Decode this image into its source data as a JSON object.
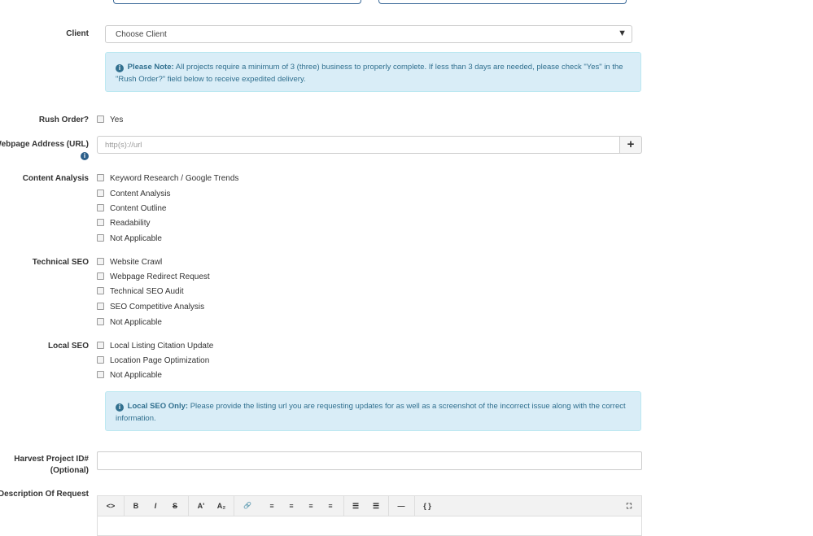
{
  "client": {
    "label": "Client",
    "select_value": "Choose Client"
  },
  "note1": {
    "title": "Please Note:",
    "text": "All projects require a minimum of 3 (three) business to properly complete. If less than 3 days are needed, please check \"Yes\" in the \"Rush Order?\" field below to receive expedited delivery."
  },
  "rush": {
    "label": "Rush Order?",
    "option": "Yes"
  },
  "url": {
    "label": "Webpage Address (URL)",
    "placeholder": "http(s)://url",
    "add_symbol": "+"
  },
  "content_analysis": {
    "label": "Content Analysis",
    "options": [
      "Keyword Research / Google Trends",
      "Content Analysis",
      "Content Outline",
      "Readability",
      "Not Applicable"
    ]
  },
  "technical_seo": {
    "label": "Technical SEO",
    "options": [
      "Website Crawl",
      "Webpage Redirect Request",
      "Technical SEO Audit",
      "SEO Competitive Analysis",
      "Not Applicable"
    ]
  },
  "local_seo": {
    "label": "Local SEO",
    "options": [
      "Local Listing Citation Update",
      "Location Page Optimization",
      "Not Applicable"
    ]
  },
  "note2": {
    "title": "Local SEO Only:",
    "text": "Please provide the listing url you are requesting updates for as well as a screenshot of the incorrect issue along with the correct information."
  },
  "harvest": {
    "label_line1": "Harvest Project ID#",
    "label_line2": "(Optional)"
  },
  "description": {
    "label": "Description Of Request"
  },
  "toolbar": {
    "code": "<>",
    "bold": "B",
    "italic": "I",
    "strike": "S",
    "superscript": "A'",
    "subscript": "A₂",
    "link": "🔗",
    "align_left": "≡",
    "align_center": "≡",
    "align_right": "≡",
    "justify": "≡",
    "ul": "☰",
    "ol": "☰",
    "hr": "—",
    "braces": "{ }",
    "fullscreen": "⛶"
  }
}
